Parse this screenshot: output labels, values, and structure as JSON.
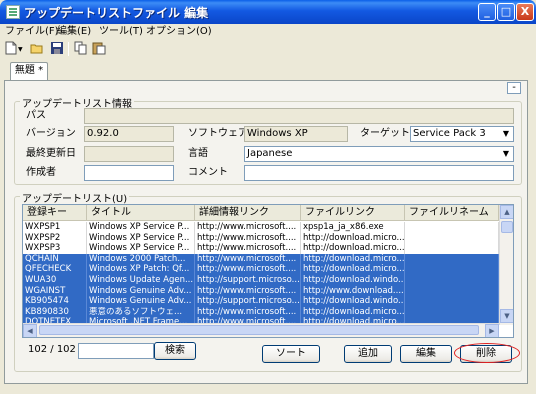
{
  "window": {
    "title": "アップデートリストファイル 編集",
    "buttons": {
      "minimize": "_",
      "maximize": "□",
      "close": "X"
    }
  },
  "menu": [
    "ファイル(F)",
    "編集(E)",
    "ツール(T)",
    "オプション(O)"
  ],
  "toolbar": {
    "icons": [
      "new-file-icon",
      "open-folder-icon",
      "save-icon",
      "copy-icon",
      "paste-icon"
    ]
  },
  "tab": {
    "label": "無題 *",
    "collapse_label": "-"
  },
  "info_group": {
    "title": "アップデートリスト情報",
    "path_label": "パス",
    "path_value": "",
    "version_label": "バージョン",
    "version_value": "0.92.0",
    "software_label": "ソフトウェア",
    "software_value": "Windows XP",
    "target_label": "ターゲット",
    "target_value": "Service Pack 3",
    "last_updated_label": "最終更新日",
    "last_updated_value": "",
    "language_label": "言語",
    "language_value": "Japanese",
    "author_label": "作成者",
    "author_value": "",
    "comment_label": "コメント",
    "comment_value": ""
  },
  "list_group": {
    "title": "アップデートリスト(U)",
    "columns": [
      "登録キー",
      "タイトル",
      "詳細情報リンク",
      "ファイルリンク",
      "ファイルリネーム"
    ],
    "rows": [
      {
        "key": "WXPSP1",
        "title": "Windows XP Service P...",
        "info": "http://www.microsoft....",
        "file": "xpsp1a_ja_x86.exe",
        "rename": "",
        "selected": false
      },
      {
        "key": "WXPSP2",
        "title": "Windows XP Service P...",
        "info": "http://www.microsoft....",
        "file": "http://download.micro...",
        "rename": "",
        "selected": false
      },
      {
        "key": "WXPSP3",
        "title": "Windows XP Service P...",
        "info": "http://www.microsoft....",
        "file": "http://download.micro...",
        "rename": "",
        "selected": false
      },
      {
        "key": "QCHAIN",
        "title": "Windows 2000 Patch...",
        "info": "http://www.microsoft....",
        "file": "http://download.micro...",
        "rename": "",
        "selected": true
      },
      {
        "key": "QFECHECK",
        "title": "Windows XP Patch: Qf...",
        "info": "http://www.microsoft....",
        "file": "http://download.micro...",
        "rename": "",
        "selected": true
      },
      {
        "key": "WUA30",
        "title": "Windows Update Agen...",
        "info": "http://support.microso...",
        "file": "http://download.windo...",
        "rename": "",
        "selected": true
      },
      {
        "key": "WGAINST",
        "title": "Windows Genuine Adv...",
        "info": "http://www.microsoft....",
        "file": "http://www.download....",
        "rename": "",
        "selected": true
      },
      {
        "key": "KB905474",
        "title": "Windows Genuine Adv...",
        "info": "http://support.microso...",
        "file": "http://download.windo...",
        "rename": "",
        "selected": true
      },
      {
        "key": "KB890830",
        "title": "悪意のあるソフトウェ...",
        "info": "http://www.microsoft....",
        "file": "http://download.micro...",
        "rename": "",
        "selected": true
      },
      {
        "key": "DOTNETFX",
        "title": "Microsoft .NET Frame...",
        "info": "http://www.microsoft....",
        "file": "http://download.micro...",
        "rename": "",
        "selected": true
      }
    ]
  },
  "bottom": {
    "count": "102 / 102",
    "search_value": "",
    "search_button": "検索",
    "sort_button": "ソート",
    "add_button": "追加",
    "edit_button": "編集",
    "delete_button": "削除"
  },
  "colors": {
    "selection": "#316AC5",
    "titlebar": "#0A46C8",
    "highlight_circle": "#E02020"
  }
}
